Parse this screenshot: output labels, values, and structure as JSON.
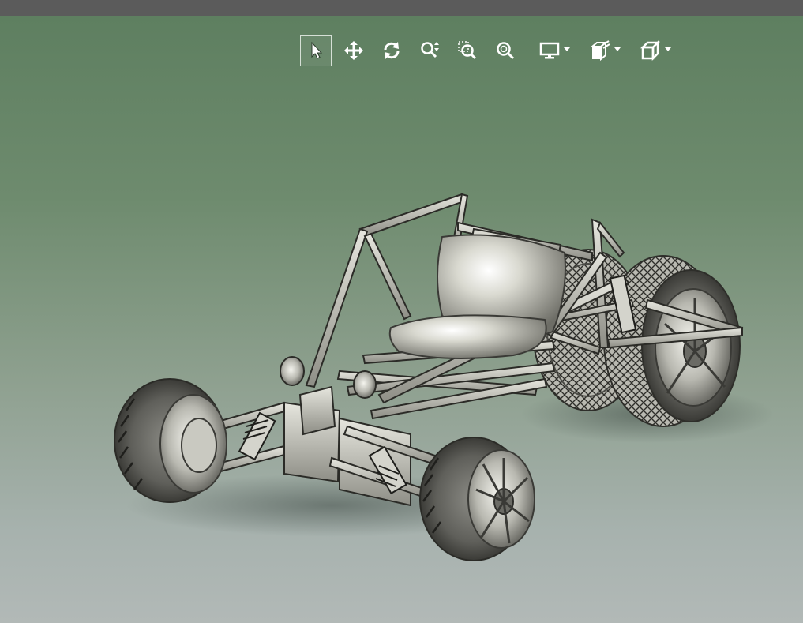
{
  "window": {
    "title_strip_color": "#5b5b5b"
  },
  "viewport": {
    "background_top": "#5e7f60",
    "background_bottom": "#b2b9b7",
    "model": "buggy-chassis-3d-model"
  },
  "toolbar": {
    "icon_color": "#ffffff",
    "tools": [
      {
        "id": "select",
        "icon": "cursor-arrow-icon",
        "active": true,
        "dropdown": false
      },
      {
        "id": "pan",
        "icon": "move-arrows-icon",
        "active": false,
        "dropdown": false
      },
      {
        "id": "rotate",
        "icon": "rotate-icon",
        "active": false,
        "dropdown": false
      },
      {
        "id": "zoom",
        "icon": "zoom-in-out-icon",
        "active": false,
        "dropdown": false
      },
      {
        "id": "zoom-window",
        "icon": "zoom-window-icon",
        "active": false,
        "dropdown": false
      },
      {
        "id": "zoom-fit",
        "icon": "zoom-fit-icon",
        "active": false,
        "dropdown": false
      },
      {
        "id": "display-style",
        "icon": "monitor-icon",
        "active": false,
        "dropdown": true
      },
      {
        "id": "section-view",
        "icon": "section-view-icon",
        "active": false,
        "dropdown": true
      },
      {
        "id": "view-orientation",
        "icon": "cube-view-icon",
        "active": false,
        "dropdown": true
      }
    ]
  }
}
